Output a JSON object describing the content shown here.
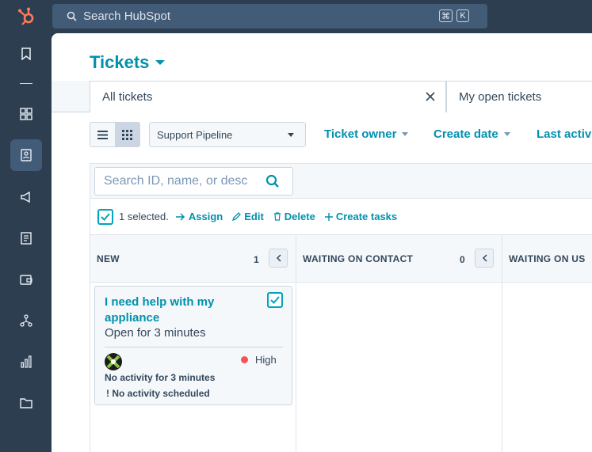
{
  "topbar": {
    "logo_icon": "hubspot-sprocket-icon",
    "search_placeholder": "Search HubSpot",
    "shortcut_cmd": "⌘",
    "shortcut_key": "K"
  },
  "leftnav": {
    "items": [
      {
        "icon": "bookmark-icon"
      },
      {
        "icon": "grid-icon"
      },
      {
        "icon": "contacts-icon",
        "active": true
      },
      {
        "icon": "megaphone-icon"
      },
      {
        "icon": "document-icon"
      },
      {
        "icon": "wallet-icon"
      },
      {
        "icon": "workflow-icon"
      },
      {
        "icon": "bar-chart-icon"
      },
      {
        "icon": "folder-icon"
      }
    ]
  },
  "page": {
    "title": "Tickets",
    "tabs": [
      {
        "label": "All tickets",
        "active": true
      },
      {
        "label": "My open tickets"
      }
    ]
  },
  "filters": {
    "pipeline": "Support Pipeline",
    "items": [
      "Ticket owner",
      "Create date",
      "Last activ"
    ]
  },
  "board": {
    "search_placeholder": "Search ID, name, or desc",
    "bulk": {
      "selected": "1 selected.",
      "actions": [
        "Assign",
        "Edit",
        "Delete",
        "Create tasks"
      ]
    },
    "columns": [
      {
        "name": "NEW",
        "count": "1"
      },
      {
        "name": "WAITING ON CONTACT",
        "count": "0"
      },
      {
        "name": "WAITING ON US",
        "count": ""
      }
    ],
    "card": {
      "title": "I need help with my appliance",
      "subtitle": "Open for 3 minutes",
      "priority": "High",
      "priority_color": "#f2545b",
      "activity": "No activity for 3 minutes",
      "scheduled": "No activity scheduled"
    }
  },
  "colors": {
    "accent": "#0091ae",
    "nav_bg": "#2d3e50",
    "checkbox": "#00a4bd"
  }
}
